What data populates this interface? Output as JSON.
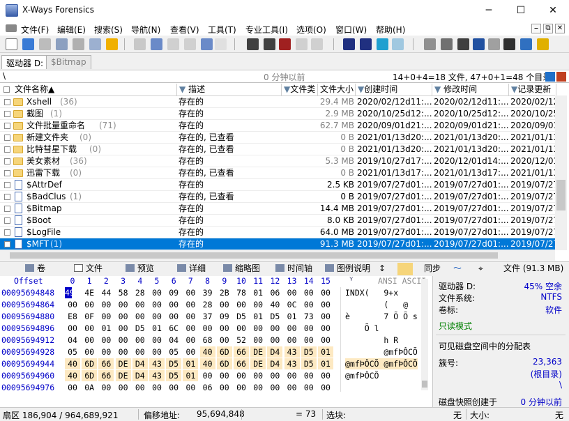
{
  "window": {
    "title": "X-Ways Forensics",
    "minimize": "─",
    "maximize": "☐",
    "close": "✕"
  },
  "menu": [
    "文件(F)",
    "编辑(E)",
    "搜索(S)",
    "导航(N)",
    "查看(V)",
    "工具(T)",
    "专业工具(I)",
    "选项(O)",
    "窗口(W)",
    "帮助(H)"
  ],
  "mdi": [
    "⎯",
    "⧉",
    "✕"
  ],
  "tabs": [
    {
      "label": "驱动器 D:",
      "active": true
    },
    {
      "label": "$Bitmap",
      "active": false
    }
  ],
  "path": {
    "text": "\\",
    "time": "0 分钟以前",
    "summary": "14+0+4=18 文件, 47+0+1=48 个目录"
  },
  "columns": [
    "文件名称▲",
    "描述",
    "文件类",
    "文件大小",
    "创建时间",
    "修改时间",
    "记录更新"
  ],
  "rows": [
    {
      "type": "folder",
      "name": "Xshell",
      "count": "(36)",
      "desc": "存在的",
      "size": "29.4 MB",
      "created": "2020/02/12d11:...",
      "modified": "2020/02/12d11:...",
      "updated": "2020/02/12",
      "dim": true
    },
    {
      "type": "folder",
      "name": "截图",
      "count": "(1)",
      "desc": "存在的",
      "size": "2.9 MB",
      "created": "2020/10/25d12:...",
      "modified": "2020/10/25d12:...",
      "updated": "2020/10/25",
      "dim": true
    },
    {
      "type": "folder",
      "name": "文件批量重命名",
      "count": "(71)",
      "desc": "存在的",
      "size": "62.7 MB",
      "created": "2020/09/01d21:...",
      "modified": "2020/09/01d21:...",
      "updated": "2020/09/01",
      "dim": true
    },
    {
      "type": "folder",
      "name": "新建文件夹",
      "count": "(0)",
      "desc": "存在的, 已查看",
      "size": "0 B",
      "created": "2021/01/13d20:...",
      "modified": "2021/01/13d20:...",
      "updated": "2021/01/13",
      "dim": true
    },
    {
      "type": "folder",
      "name": "比特彗星下载",
      "count": "(0)",
      "desc": "存在的, 已查看",
      "size": "0 B",
      "created": "2021/01/13d20:...",
      "modified": "2021/01/13d20:...",
      "updated": "2021/01/13",
      "dim": true
    },
    {
      "type": "folder",
      "name": "美女素材",
      "count": "(36)",
      "desc": "存在的",
      "size": "5.3 MB",
      "created": "2019/10/27d17:...",
      "modified": "2020/12/01d14:...",
      "updated": "2020/12/01",
      "dim": true
    },
    {
      "type": "folder",
      "name": "迅雷下载",
      "count": "(0)",
      "desc": "存在的, 已查看",
      "size": "0 B",
      "created": "2021/01/13d17:...",
      "modified": "2021/01/13d17:...",
      "updated": "2021/01/13",
      "dim": true
    },
    {
      "type": "file",
      "name": "$AttrDef",
      "count": "",
      "desc": "存在的",
      "size": "2.5 KB",
      "created": "2019/07/27d01:...",
      "modified": "2019/07/27d01:...",
      "updated": "2019/07/27",
      "dim": false
    },
    {
      "type": "file",
      "name": "$BadClus",
      "count": "(1)",
      "desc": "存在的, 已查看",
      "size": "0 B",
      "created": "2019/07/27d01:...",
      "modified": "2019/07/27d01:...",
      "updated": "2019/07/27",
      "dim": false
    },
    {
      "type": "file",
      "name": "$Bitmap",
      "count": "",
      "desc": "存在的",
      "size": "14.4 MB",
      "created": "2019/07/27d01:...",
      "modified": "2019/07/27d01:...",
      "updated": "2019/07/27",
      "dim": false
    },
    {
      "type": "file",
      "name": "$Boot",
      "count": "",
      "desc": "存在的",
      "size": "8.0 KB",
      "created": "2019/07/27d01:...",
      "modified": "2019/07/27d01:...",
      "updated": "2019/07/27",
      "dim": false
    },
    {
      "type": "file",
      "name": "$LogFile",
      "count": "",
      "desc": "存在的",
      "size": "64.0 MB",
      "created": "2019/07/27d01:...",
      "modified": "2019/07/27d01:...",
      "updated": "2019/07/27",
      "dim": false
    },
    {
      "type": "file",
      "name": "$MFT",
      "count": "(1)",
      "desc": "存在的",
      "size": "91.3 MB",
      "created": "2019/07/27d01:...",
      "modified": "2019/07/27d01:...",
      "updated": "2019/07/27",
      "dim": false,
      "selected": true
    }
  ],
  "modes": [
    "卷",
    "文件",
    "预览",
    "详细",
    "缩略图",
    "时间轴",
    "图例说明",
    "↕",
    "同步",
    "(91.3 MB)"
  ],
  "mode_file_label": "文件",
  "hex": {
    "header_offset": "Offset",
    "header_cols": [
      "0",
      "1",
      "2",
      "3",
      "4",
      "5",
      "6",
      "7",
      "8",
      "9",
      "10",
      "11",
      "12",
      "13",
      "14",
      "15"
    ],
    "header_ascii": "ANSI ASCII",
    "rows": [
      {
        "off": "00095694848",
        "bytes": [
          "49",
          "4E",
          "44",
          "58",
          "28",
          "00",
          "09",
          "00",
          "39",
          "2B",
          "78",
          "01",
          "06",
          "00",
          "00",
          "00"
        ],
        "ascii": "INDX(   9+x",
        "hl": []
      },
      {
        "off": "00095694864",
        "bytes": [
          "00",
          "00",
          "00",
          "00",
          "00",
          "00",
          "00",
          "00",
          "28",
          "00",
          "00",
          "00",
          "40",
          "0C",
          "00",
          "00"
        ],
        "ascii": "        (   @",
        "hl": []
      },
      {
        "off": "00095694880",
        "bytes": [
          "E8",
          "0F",
          "00",
          "00",
          "00",
          "00",
          "00",
          "00",
          "37",
          "09",
          "D5",
          "01",
          "D5",
          "01",
          "73",
          "00"
        ],
        "ascii": "è       7 Õ Õ s",
        "hl": []
      },
      {
        "off": "00095694896",
        "bytes": [
          "00",
          "00",
          "01",
          "00",
          "D5",
          "01",
          "6C",
          "00",
          "00",
          "00",
          "00",
          "00",
          "00",
          "00",
          "00",
          "00"
        ],
        "ascii": "    Õ l",
        "hl": []
      },
      {
        "off": "00095694912",
        "bytes": [
          "04",
          "00",
          "00",
          "00",
          "00",
          "00",
          "04",
          "00",
          "68",
          "00",
          "52",
          "00",
          "00",
          "00",
          "00",
          "00"
        ],
        "ascii": "        h R",
        "hl": []
      },
      {
        "off": "00095694928",
        "bytes": [
          "05",
          "00",
          "00",
          "00",
          "00",
          "00",
          "05",
          "00",
          "40",
          "6D",
          "66",
          "DE",
          "D4",
          "43",
          "D5",
          "01"
        ],
        "ascii": "        @mfÞÔCÕ",
        "hl": [
          8,
          9,
          10,
          11,
          12,
          13,
          14,
          15
        ]
      },
      {
        "off": "00095694944",
        "bytes": [
          "40",
          "6D",
          "66",
          "DE",
          "D4",
          "43",
          "D5",
          "01",
          "40",
          "6D",
          "66",
          "DE",
          "D4",
          "43",
          "D5",
          "01"
        ],
        "ascii": "@mfÞÔCÕ @mfÞÔCÕ",
        "hl": [
          0,
          1,
          2,
          3,
          4,
          5,
          6,
          7,
          8,
          9,
          10,
          11,
          12,
          13,
          14,
          15
        ]
      },
      {
        "off": "00095694960",
        "bytes": [
          "40",
          "6D",
          "66",
          "DE",
          "D4",
          "43",
          "D5",
          "01",
          "00",
          "00",
          "00",
          "00",
          "00",
          "00",
          "00",
          "00"
        ],
        "ascii": "@mfÞÔCÕ",
        "hl": [
          0,
          1,
          2,
          3,
          4,
          5,
          6,
          7
        ]
      },
      {
        "off": "00095694976",
        "bytes": [
          "00",
          "0A",
          "00",
          "00",
          "00",
          "00",
          "00",
          "00",
          "06",
          "00",
          "00",
          "00",
          "00",
          "00",
          "00",
          "00"
        ],
        "ascii": "",
        "hl": []
      }
    ]
  },
  "info": {
    "drive_label": "驱动器 D:",
    "drive_value": "45% 空余",
    "fs_label": "文件系统:",
    "fs_value": "NTFS",
    "vol_label": "卷标:",
    "vol_value": "软件",
    "readonly": "只读模式",
    "alloc_title": "可见磁盘空间中的分配表",
    "cluster_label": "簇号:",
    "cluster_value": "23,363",
    "cluster_sub": "(根目录)",
    "cluster_path": "\\",
    "snapshot_label": "磁盘快照创建于",
    "snapshot_value": "0 分钟以前"
  },
  "status": {
    "sector": "扇区 186,904 / 964,689,921",
    "offset_label": "偏移地址:",
    "offset_value": "95,694,848",
    "eq": "= 73",
    "sel_label": "选块:",
    "sel_value": "无",
    "size_label": "大小:",
    "size_value": "无"
  },
  "colors": {
    "selection": "#0078d7",
    "offset_blue": "#0000c8",
    "highlight": "#fde9c2",
    "readonly_green": "#008000"
  }
}
